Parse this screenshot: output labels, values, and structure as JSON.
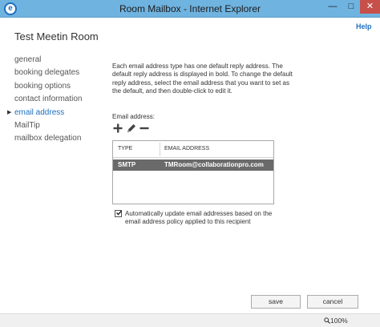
{
  "window": {
    "title": "Room Mailbox - Internet Explorer",
    "minimize_glyph": "—",
    "maximize_glyph": "□",
    "close_glyph": "✕",
    "logo_glyph": "e"
  },
  "header": {
    "help_label": "Help",
    "page_title": "Test Meetin Room"
  },
  "nav": {
    "active_arrow": "▶",
    "items": [
      {
        "label": "general"
      },
      {
        "label": "booking delegates"
      },
      {
        "label": "booking options"
      },
      {
        "label": "contact information"
      },
      {
        "label": "email address"
      },
      {
        "label": "MailTip"
      },
      {
        "label": "mailbox delegation"
      }
    ]
  },
  "main": {
    "description": "Each email address type has one default reply address. The default reply address is displayed in bold. To change the default reply address, select the email address that you want to set as the default, and then double-click to edit it.",
    "field_label": "Email address:",
    "table": {
      "columns": [
        "TYPE",
        "EMAIL ADDRESS"
      ],
      "rows": [
        {
          "type": "SMTP",
          "address": "TMRoom@collaborationpro.com"
        }
      ]
    },
    "auto_update_checked": true,
    "auto_update_label": "Automatically update email addresses based on the email address policy applied to this recipient"
  },
  "footer": {
    "save_label": "save",
    "cancel_label": "cancel",
    "zoom_label": "100%",
    "zoom_icon_glyph": "🔍"
  },
  "colors": {
    "titlebar": "#6fb3e0",
    "accent": "#1e6fbf",
    "selected_row": "#6a6a6a",
    "close_button": "#c7504b"
  },
  "icons": {
    "add": "plus-icon",
    "edit": "pencil-icon",
    "remove": "minus-icon",
    "browser": "internet-explorer-icon"
  }
}
